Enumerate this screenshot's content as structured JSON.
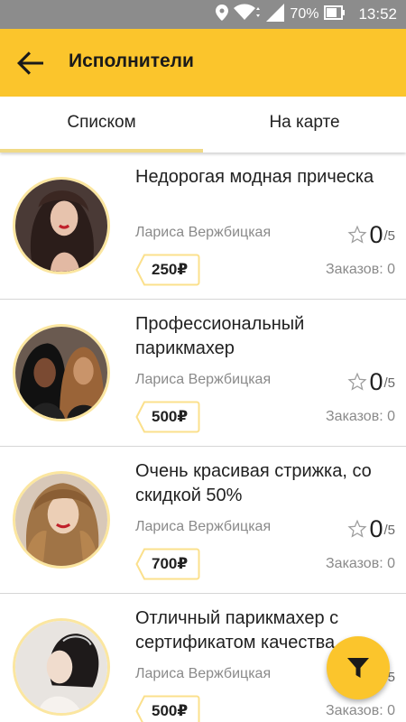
{
  "status_bar": {
    "battery_percent": "70%",
    "time": "13:52",
    "icons": [
      "location-icon",
      "wifi-icon",
      "signal-icon",
      "battery-icon"
    ]
  },
  "app_bar": {
    "title": "Исполнители",
    "back_icon": "arrow-left-icon"
  },
  "tabs": [
    {
      "label": "Списком",
      "active": true
    },
    {
      "label": "На карте",
      "active": false
    }
  ],
  "colors": {
    "accent": "#fbc52c",
    "tab_indicator": "#f0da86",
    "status_bar": "#8c8c8c",
    "avatar_border": "#fbe6a0"
  },
  "items": [
    {
      "title": "Недорогая модная прическа",
      "author": "Лариса Вержбицкая",
      "rating": "0",
      "rating_max": "/5",
      "price": "250₽",
      "orders": "Заказов: 0"
    },
    {
      "title": "Профессиональный парикмахер",
      "author": "Лариса Вержбицкая",
      "rating": "0",
      "rating_max": "/5",
      "price": "500₽",
      "orders": "Заказов: 0"
    },
    {
      "title": "Очень красивая стрижка, со скидкой 50%",
      "author": "Лариса Вержбицкая",
      "rating": "0",
      "rating_max": "/5",
      "price": "700₽",
      "orders": "Заказов: 0"
    },
    {
      "title": "Отличный парикмахер с сертификатом качества",
      "author": "Лариса Вержбицкая",
      "rating": "0",
      "rating_max": "/5",
      "price": "500₽",
      "orders": "Заказов: 0"
    }
  ],
  "fab": {
    "icon": "filter-icon"
  }
}
